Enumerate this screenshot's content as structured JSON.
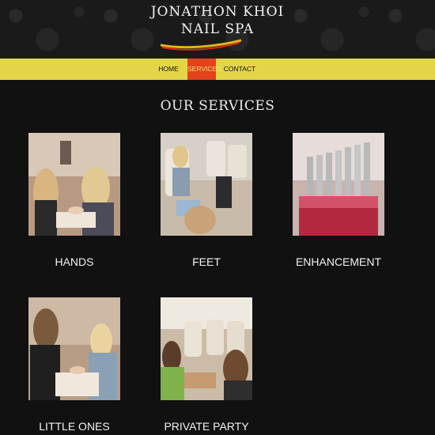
{
  "logo": {
    "line1": "JONATHON KHOI",
    "line2": "NAIL SPA"
  },
  "nav": {
    "items": [
      "HOME",
      "SERVICES",
      "CONTACT"
    ],
    "active": "SERVICES"
  },
  "section_title": "OUR SERVICES",
  "services": [
    "HANDS",
    "FEET",
    "ENHANCEMENT",
    "LITTLE ONES",
    "PRIVATE PARTY"
  ],
  "colors": {
    "nav_bar": "#e4d548",
    "nav_active": "#e3421d",
    "background": "#111111"
  }
}
